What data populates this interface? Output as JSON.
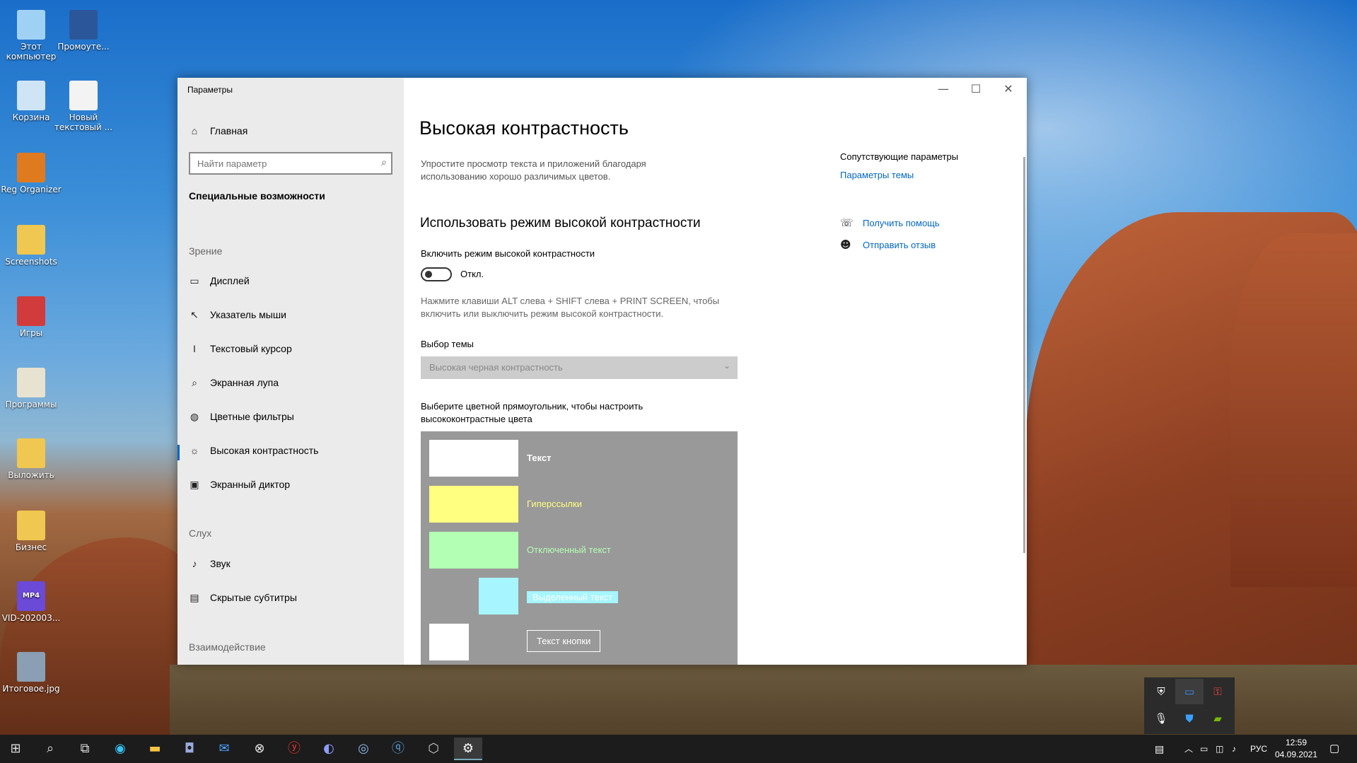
{
  "desktop": {
    "icons": [
      {
        "label": "Этот компьютер",
        "color": "#9fd1f5"
      },
      {
        "label": "Промоуте...",
        "color": "#2b579a"
      },
      {
        "label": "Корзина",
        "color": "#cfe4f4"
      },
      {
        "label": "Новый текстовый ...",
        "color": "#f3f3f3"
      },
      {
        "label": "Reg Organizer",
        "color": "#e07a1f"
      },
      {
        "label": "Screenshots",
        "color": "#f0c750"
      },
      {
        "label": "Игры",
        "color": "#d23b3b"
      },
      {
        "label": "Программы",
        "color": "#e8e2d0"
      },
      {
        "label": "Выложить",
        "color": "#f0c750"
      },
      {
        "label": "Бизнес",
        "color": "#f0c750"
      },
      {
        "label": "VID-202003...",
        "color": "#6a4ad6",
        "badge": "MP4"
      },
      {
        "label": "Итоговое.jpg",
        "color": "#8a9fb3"
      }
    ]
  },
  "window": {
    "title": "Параметры",
    "controls": {
      "minimize": "—",
      "maximize": "☐",
      "close": "✕"
    }
  },
  "sidebar": {
    "home": "Главная",
    "search_placeholder": "Найти параметр",
    "category": "Специальные возможности",
    "sections": {
      "vision": "Зрение",
      "hearing": "Слух",
      "interaction": "Взаимодействие"
    },
    "items": [
      {
        "label": "Дисплей",
        "icon": "monitor-icon",
        "glyph": "▭"
      },
      {
        "label": "Указатель мыши",
        "icon": "mouse-pointer-icon",
        "glyph": "↖"
      },
      {
        "label": "Текстовый курсор",
        "icon": "text-cursor-icon",
        "glyph": "I"
      },
      {
        "label": "Экранная лупа",
        "icon": "magnifier-icon",
        "glyph": "⌕"
      },
      {
        "label": "Цветные фильтры",
        "icon": "palette-icon",
        "glyph": "◍"
      },
      {
        "label": "Высокая контрастность",
        "icon": "brightness-icon",
        "glyph": "☼"
      },
      {
        "label": "Экранный диктор",
        "icon": "narrator-icon",
        "glyph": "▣"
      },
      {
        "label": "Звук",
        "icon": "speaker-icon",
        "glyph": "♪"
      },
      {
        "label": "Скрытые субтитры",
        "icon": "captions-icon",
        "glyph": "▤"
      }
    ]
  },
  "main": {
    "title": "Высокая контрастность",
    "description": [
      "Упростите просмотр текста и приложений благодаря",
      "использованию хорошо различимых цветов."
    ],
    "subheading": "Использовать режим высокой контрастности",
    "toggle_label": "Включить режим высокой контрастности",
    "toggle_state": "Откл.",
    "toggle_on": false,
    "hint": [
      "Нажмите клавиши ALT слева + SHIFT слева + PRINT SCREEN, чтобы",
      "включить или выключить режим высокой контрастности."
    ],
    "theme_label": "Выбор темы",
    "theme_value": "Высокая черная контрастность",
    "palette_label": [
      "Выберите цветной прямоугольник, чтобы настроить",
      "высококонтрастные цвета"
    ],
    "palette": {
      "text": {
        "label": "Текст",
        "color": "#ffffff"
      },
      "hyperlinks": {
        "label": "Гиперссылки",
        "color": "#ffff80"
      },
      "disabled": {
        "label": "Отключенный текст",
        "color": "#b3ffb3"
      },
      "selected": {
        "label": "Выделенный текст",
        "color": "#a6f5ff"
      },
      "button": {
        "label": "Текст кнопки",
        "color": "#ffffff"
      }
    }
  },
  "related": {
    "heading": "Сопутствующие параметры",
    "theme_link": "Параметры темы",
    "help": "Получить помощь",
    "feedback": "Отправить отзыв"
  },
  "taskbar": {
    "lang": "РУС",
    "time": "12:59",
    "date": "04.09.2021"
  },
  "colors": {
    "accent": "#0067c0",
    "link": "#0067c0"
  }
}
